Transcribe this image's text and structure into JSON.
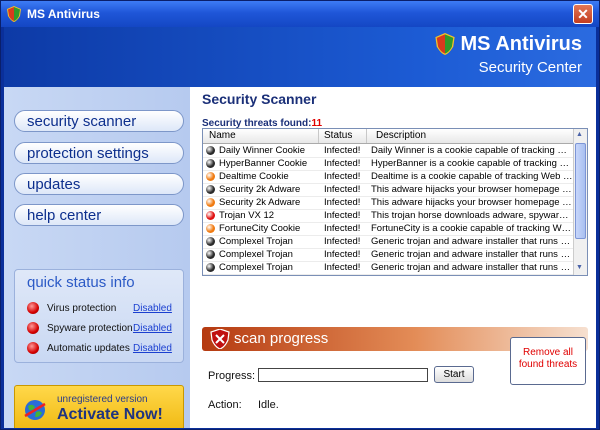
{
  "window": {
    "title": "MS Antivirus"
  },
  "banner": {
    "brand": "MS Antivirus",
    "subtitle": "Security Center"
  },
  "nav": {
    "items": [
      {
        "label": "security scanner"
      },
      {
        "label": "protection settings"
      },
      {
        "label": "updates"
      },
      {
        "label": "help center"
      }
    ]
  },
  "quick_status": {
    "title": "quick status info",
    "items": [
      {
        "label": "Virus protection",
        "value": "Disabled"
      },
      {
        "label": "Spyware protection",
        "value": "Disabled"
      },
      {
        "label": "Automatic updates",
        "value": "Disabled"
      }
    ]
  },
  "activate": {
    "small": "unregistered version",
    "big": "Activate Now!"
  },
  "scanner": {
    "title": "Security Scanner",
    "threats_label": "Security threats found:",
    "threats_count": "11",
    "columns": [
      "Name",
      "Status",
      "Description"
    ],
    "rows": [
      {
        "name": "Daily Winner Cookie",
        "status": "Infected!",
        "description": "Daily Winner is a cookie capable of tracking Web ...",
        "icon_color": "#2a2a2a"
      },
      {
        "name": "HyperBanner Cookie",
        "status": "Infected!",
        "description": "HyperBanner is a cookie capable of tracking Web ...",
        "icon_color": "#2a2a2a"
      },
      {
        "name": "Dealtime Cookie",
        "status": "Infected!",
        "description": "Dealtime is a cookie capable of tracking Web site ...",
        "icon_color": "#f07a10"
      },
      {
        "name": "Security 2k Adware",
        "status": "Infected!",
        "description": "This adware hijacks your browser homepage and ...",
        "icon_color": "#2a2a2a"
      },
      {
        "name": "Security 2k Adware",
        "status": "Infected!",
        "description": "This adware hijacks your browser homepage and ...",
        "icon_color": "#f07a10"
      },
      {
        "name": "Trojan VX 12",
        "status": "Infected!",
        "description": "This trojan horse downloads adware, spyware, an...",
        "icon_color": "#e01010"
      },
      {
        "name": "FortuneCity Cookie",
        "status": "Infected!",
        "description": "FortuneCity is a cookie capable of tracking Web si...",
        "icon_color": "#f07a10"
      },
      {
        "name": "Complexel Trojan",
        "status": "Infected!",
        "description": "Generic trojan and adware installer that runs vario...",
        "icon_color": "#2a2a2a"
      },
      {
        "name": "Complexel Trojan",
        "status": "Infected!",
        "description": "Generic trojan and adware installer that runs vario...",
        "icon_color": "#2a2a2a"
      },
      {
        "name": "Complexel Trojan",
        "status": "Infected!",
        "description": "Generic trojan and adware installer that runs vario...",
        "icon_color": "#2a2a2a"
      }
    ]
  },
  "progress": {
    "banner_label": "scan progress",
    "progress_label": "Progress:",
    "start_label": "Start",
    "action_label": "Action:",
    "action_value": "Idle.",
    "remove_label": "Remove all found threats"
  }
}
